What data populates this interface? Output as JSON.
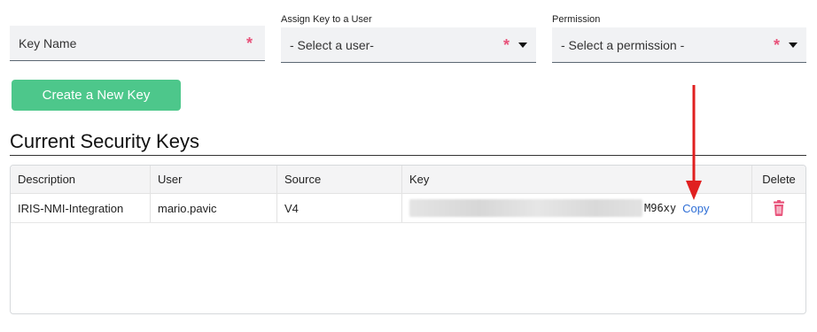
{
  "form": {
    "key_name": {
      "placeholder": "Key Name",
      "required_mark": "*"
    },
    "assign_user": {
      "label": "Assign Key to a User",
      "value": "- Select a user-",
      "required_mark": "*",
      "caret_icon": "caret-down-icon"
    },
    "permission": {
      "label": "Permission",
      "value": "- Select a permission -",
      "required_mark": "*",
      "caret_icon": "caret-down-icon"
    },
    "create_button_label": "Create a New Key"
  },
  "section_title": "Current Security Keys",
  "table": {
    "headers": [
      "Description",
      "User",
      "Source",
      "Key",
      "Delete"
    ],
    "rows": [
      {
        "description": "IRIS-NMI-Integration",
        "user": "mario.pavic",
        "source": "V4",
        "key_suffix": "M96xy",
        "copy_label": "Copy",
        "delete_icon": "trash-icon"
      }
    ]
  },
  "colors": {
    "accent_green": "#4dc78b",
    "required_red": "#e8537a",
    "link_blue": "#2f6fd6",
    "annotation_arrow": "#e02020"
  },
  "annotation": {
    "icon": "red-arrow-down-icon"
  }
}
